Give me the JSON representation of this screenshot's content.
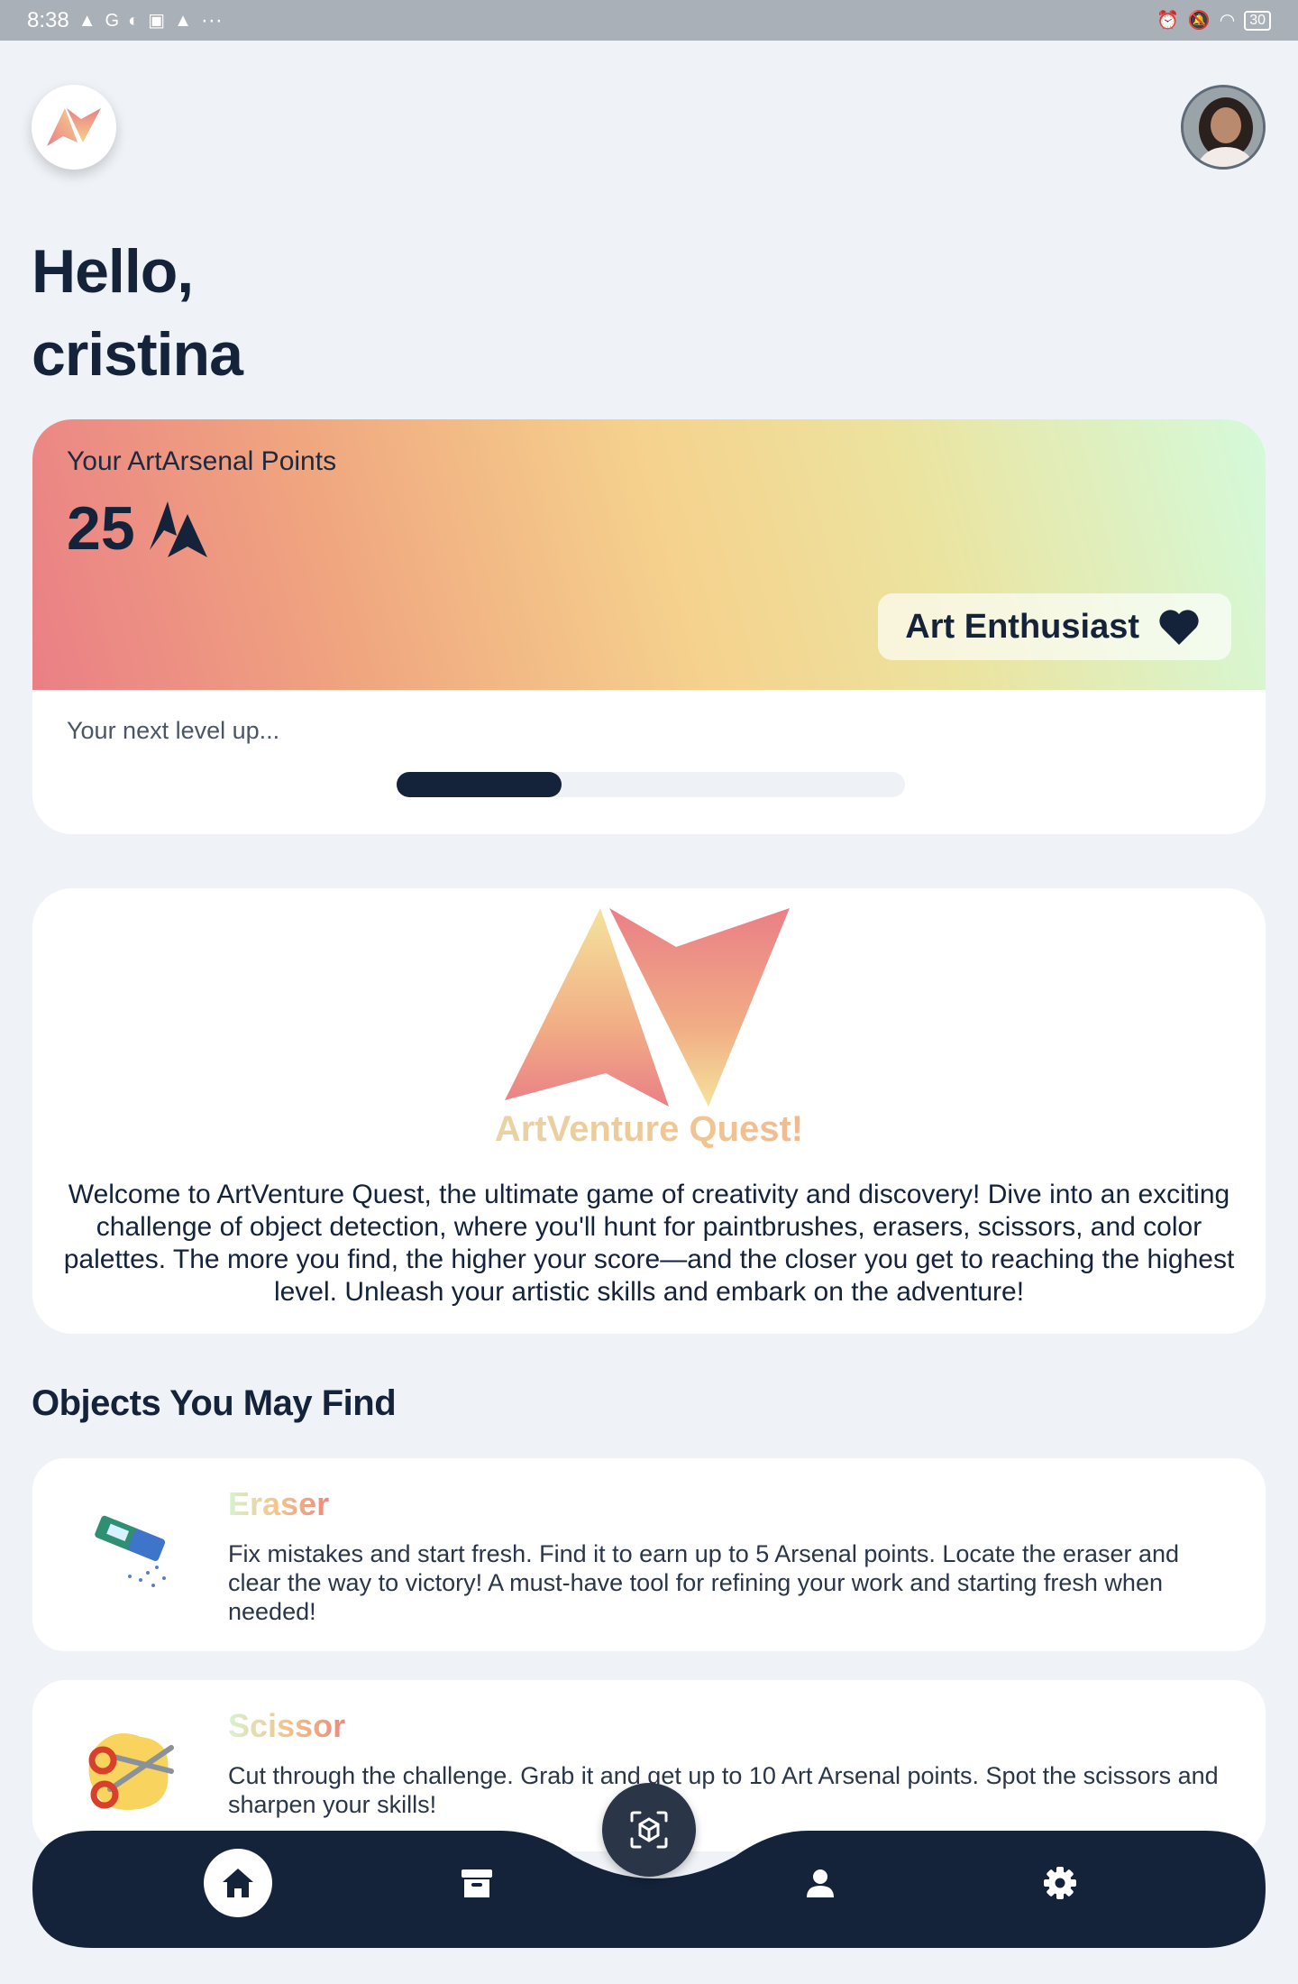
{
  "status_bar": {
    "time": "8:38",
    "more": "···",
    "battery": "30"
  },
  "header": {
    "greeting_line1": "Hello,",
    "greeting_line2": "cristina"
  },
  "points_card": {
    "label": "Your ArtArsenal Points",
    "points": "25",
    "level_badge": "Art Enthusiast",
    "next_level_label": "Your next level up...",
    "progress_fraction": 0.325
  },
  "welcome_card": {
    "title": "ArtVenture Quest!",
    "text": "Welcome to ArtVenture Quest, the ultimate game of creativity and discovery! Dive into an exciting challenge of object detection, where you'll hunt for paintbrushes, erasers, scissors, and color palettes. The more you find, the higher your score—and the closer you get to reaching the highest level. Unleash your artistic skills and embark on the adventure!"
  },
  "objects_section": {
    "title": "Objects You May Find",
    "items": [
      {
        "name": "Eraser",
        "icon": "eraser-icon",
        "description": "Fix mistakes and start fresh. Find it to earn up to 5 Arsenal points. Locate the eraser and clear the way to victory! A must-have tool for refining your work and starting fresh when needed!"
      },
      {
        "name": "Scissor",
        "icon": "scissors-icon",
        "description": "Cut through the challenge. Grab it and get up to 10 Art Arsenal points. Spot the scissors and sharpen your skills!"
      }
    ]
  },
  "bottom_nav": {
    "items": [
      "home-icon",
      "archive-icon",
      "scan-icon",
      "profile-icon",
      "settings-icon"
    ],
    "active": "home-icon"
  },
  "colors": {
    "navy": "#14233a",
    "background": "#eff3f7",
    "gradient_start": "#ea7f86",
    "gradient_mid": "#f5d28d",
    "gradient_end": "#d4fadb"
  }
}
